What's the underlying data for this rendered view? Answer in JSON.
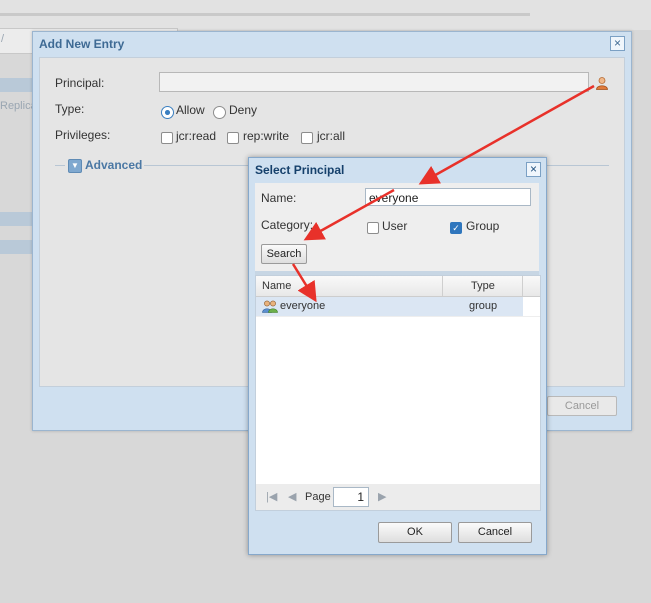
{
  "background": {
    "left_tab_fragment": "/",
    "side_fragment": "Replica"
  },
  "add_entry_dialog": {
    "title": "Add New Entry",
    "principal_label": "Principal:",
    "principal_value": "",
    "type_label": "Type:",
    "type_options": [
      {
        "label": "Allow",
        "selected": true
      },
      {
        "label": "Deny",
        "selected": false
      }
    ],
    "privileges_label": "Privileges:",
    "privileges": [
      {
        "label": "jcr:read",
        "checked": false
      },
      {
        "label": "rep:write",
        "checked": false
      },
      {
        "label": "jcr:all",
        "checked": false
      }
    ],
    "advanced_label": "Advanced",
    "cancel_label": "Cancel"
  },
  "select_principal_dialog": {
    "title": "Select Principal",
    "name_label": "Name:",
    "name_value": "everyone",
    "category_label": "Category:",
    "categories": [
      {
        "label": "User",
        "checked": false
      },
      {
        "label": "Group",
        "checked": true
      }
    ],
    "search_label": "Search",
    "columns": [
      "Name",
      "Type"
    ],
    "rows": [
      {
        "name": "everyone",
        "type": "group"
      }
    ],
    "page_label": "Page",
    "page_value": "1",
    "ok_label": "OK",
    "cancel_label": "Cancel"
  },
  "colors": {
    "arrow": "#e8312a",
    "dialog_frame": "#cfe0f0",
    "selected_row": "#dbe6f3"
  }
}
